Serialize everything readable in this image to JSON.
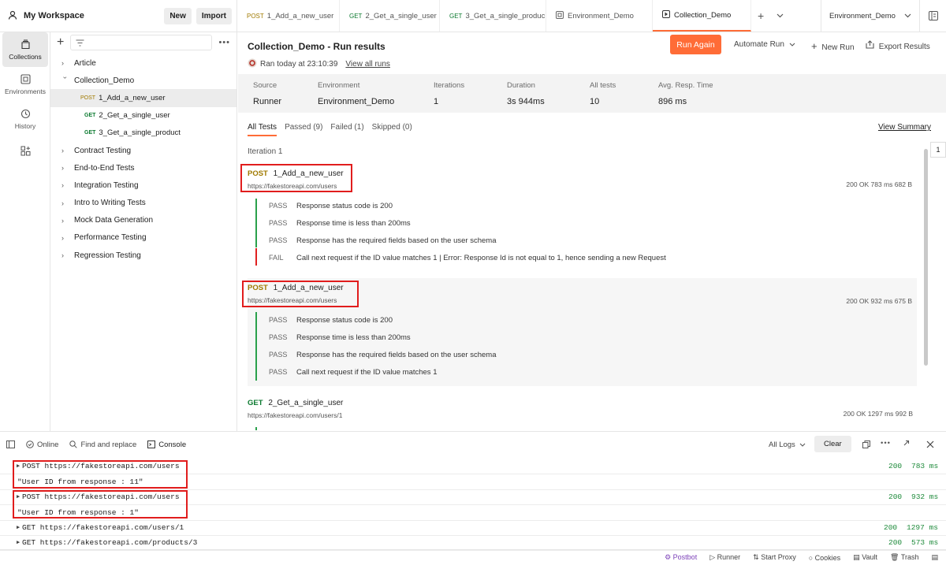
{
  "header": {
    "workspace": "My Workspace",
    "new_label": "New",
    "import_label": "Import",
    "tabs": [
      {
        "method": "POST",
        "label": "1_Add_a_new_user"
      },
      {
        "method": "GET",
        "label": "2_Get_a_single_user"
      },
      {
        "method": "GET",
        "label": "3_Get_a_single_produc"
      },
      {
        "method": "",
        "label": "Environment_Demo"
      },
      {
        "method": "",
        "label": "Collection_Demo"
      }
    ],
    "env_selected": "Environment_Demo"
  },
  "rail": {
    "items": [
      {
        "label": "Collections",
        "icon": "collections-icon"
      },
      {
        "label": "Environments",
        "icon": "environments-icon"
      },
      {
        "label": "History",
        "icon": "history-icon"
      }
    ]
  },
  "sidebar": {
    "items": [
      {
        "label": "Article"
      },
      {
        "label": "Collection_Demo"
      },
      {
        "method": "POST",
        "label": "1_Add_a_new_user"
      },
      {
        "method": "GET",
        "label": "2_Get_a_single_user"
      },
      {
        "method": "GET",
        "label": "3_Get_a_single_product"
      },
      {
        "label": "Contract Testing"
      },
      {
        "label": "End-to-End Tests"
      },
      {
        "label": "Integration Testing"
      },
      {
        "label": "Intro to Writing Tests"
      },
      {
        "label": "Mock Data Generation"
      },
      {
        "label": "Performance Testing"
      },
      {
        "label": "Regression Testing"
      }
    ]
  },
  "run": {
    "title": "Collection_Demo - Run results",
    "ran_text": "Ran today at 23:10:39",
    "view_all": "View all runs",
    "run_again": "Run Again",
    "automate": "Automate Run",
    "new_run": "New Run",
    "export": "Export Results",
    "summary": {
      "source_label": "Source",
      "source": "Runner",
      "env_label": "Environment",
      "env": "Environment_Demo",
      "iter_label": "Iterations",
      "iterations": "1",
      "dur_label": "Duration",
      "duration": "3s 944ms",
      "tests_label": "All tests",
      "tests": "10",
      "avg_label": "Avg. Resp. Time",
      "avg": "896 ms"
    },
    "filter_tabs": [
      "All Tests",
      "Passed (9)",
      "Failed (1)",
      "Skipped (0)"
    ],
    "view_summary": "View Summary",
    "iteration_label": "Iteration 1",
    "iteration_tab": "1",
    "requests": [
      {
        "method": "POST",
        "name": "1_Add_a_new_user",
        "url": "https://fakestoreapi.com/users",
        "meta": "200 OK   783 ms   682 B",
        "tests": [
          {
            "status": "PASS",
            "text": "Response status code is 200"
          },
          {
            "status": "PASS",
            "text": "Response time is less than 200ms"
          },
          {
            "status": "PASS",
            "text": "Response has the required fields based on the user schema"
          },
          {
            "status": "FAIL",
            "text": "Call next request if the ID value matches 1 | Error: Response Id is not equal to 1, hence sending a new Request"
          }
        ]
      },
      {
        "method": "POST",
        "name": "1_Add_a_new_user",
        "url": "https://fakestoreapi.com/users",
        "meta": "200 OK   932 ms   675 B",
        "tests": [
          {
            "status": "PASS",
            "text": "Response status code is 200"
          },
          {
            "status": "PASS",
            "text": "Response time is less than 200ms"
          },
          {
            "status": "PASS",
            "text": "Response has the required fields based on the user schema"
          },
          {
            "status": "PASS",
            "text": "Call next request if the ID value matches 1"
          }
        ]
      },
      {
        "method": "GET",
        "name": "2_Get_a_single_user",
        "url": "https://fakestoreapi.com/users/1",
        "meta": "200 OK   1297 ms   992 B"
      }
    ]
  },
  "console": {
    "online": "Online",
    "find": "Find and replace",
    "console": "Console",
    "all_logs": "All Logs",
    "clear": "Clear",
    "logs": [
      {
        "text": "POST https://fakestoreapi.com/users",
        "status": "200",
        "time": "783 ms",
        "expandable": true
      },
      {
        "text": "\"User ID from response : 11\"",
        "status": "",
        "time": "",
        "expandable": false
      },
      {
        "text": "POST https://fakestoreapi.com/users",
        "status": "200",
        "time": "932 ms",
        "expandable": true
      },
      {
        "text": "\"User ID from response : 1\"",
        "status": "",
        "time": "",
        "expandable": false
      },
      {
        "text": "GET https://fakestoreapi.com/users/1",
        "status": "200",
        "time": "1297 ms",
        "expandable": true
      },
      {
        "text": "GET https://fakestoreapi.com/products/3",
        "status": "200",
        "time": "573 ms",
        "expandable": true
      }
    ]
  },
  "statusbar": [
    "Postbot",
    "Runner",
    "Start Proxy",
    "Cookies",
    "Vault",
    "Trash"
  ],
  "colors": {
    "accent": "#ff6c37",
    "post": "#a07a00",
    "get": "#0c7a30",
    "pass": "#2aa14b",
    "fail": "#e02020",
    "highlight": "#e11d1d"
  }
}
